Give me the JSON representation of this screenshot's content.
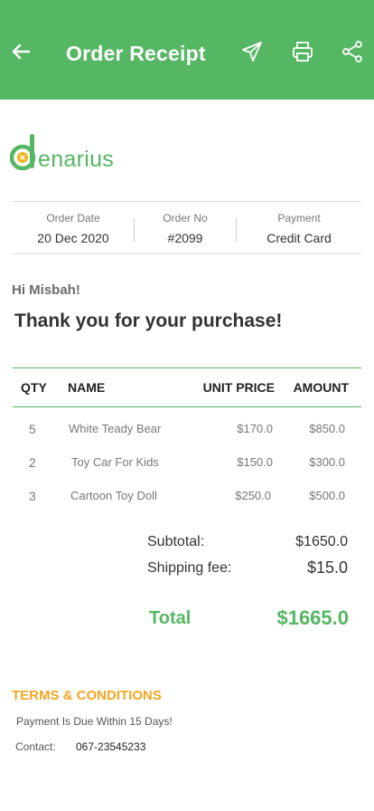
{
  "appbar": {
    "title": "Order Receipt",
    "icons": [
      "back-arrow-icon",
      "send-icon",
      "print-icon",
      "share-icon"
    ],
    "color": "#55b663"
  },
  "brand": {
    "logo_text": "denarius",
    "logo_letter": "d",
    "color": "#55b663"
  },
  "order": {
    "date_label": "Order Date",
    "date": "20 Dec 2020",
    "number_label": "Order No",
    "number": "#2099",
    "payment_label": "Payment",
    "payment": "Credit Card"
  },
  "greeting": "Hi Misbah!",
  "headline": "Thank you for your purchase!",
  "table": {
    "headers": {
      "qty": "QTY",
      "name": "NAME",
      "unit_price": "UNIT PRICE",
      "amount": "AMOUNT"
    },
    "rows": [
      {
        "qty": "5",
        "name": "White Teady Bear",
        "unit_price": "$170.0",
        "amount": "$850.0"
      },
      {
        "qty": "2",
        "name": "Toy Car For Kids",
        "unit_price": "$150.0",
        "amount": "$300.0"
      },
      {
        "qty": "3",
        "name": "Cartoon Toy Doll",
        "unit_price": "$250.0",
        "amount": "$500.0"
      }
    ]
  },
  "summary": {
    "subtotal_label": "Subtotal:",
    "subtotal": "$1650.0",
    "shipping_label": "Shipping fee:",
    "shipping": "$15.0",
    "total_label": "Total",
    "total": "$1665.0"
  },
  "terms": {
    "title": "TERMS & CONDITIONS",
    "due_text": "Payment Is Due Within 15 Days!",
    "contact_label": "Contact:",
    "contact_value": "067-23545233",
    "color": "#f5a623"
  }
}
